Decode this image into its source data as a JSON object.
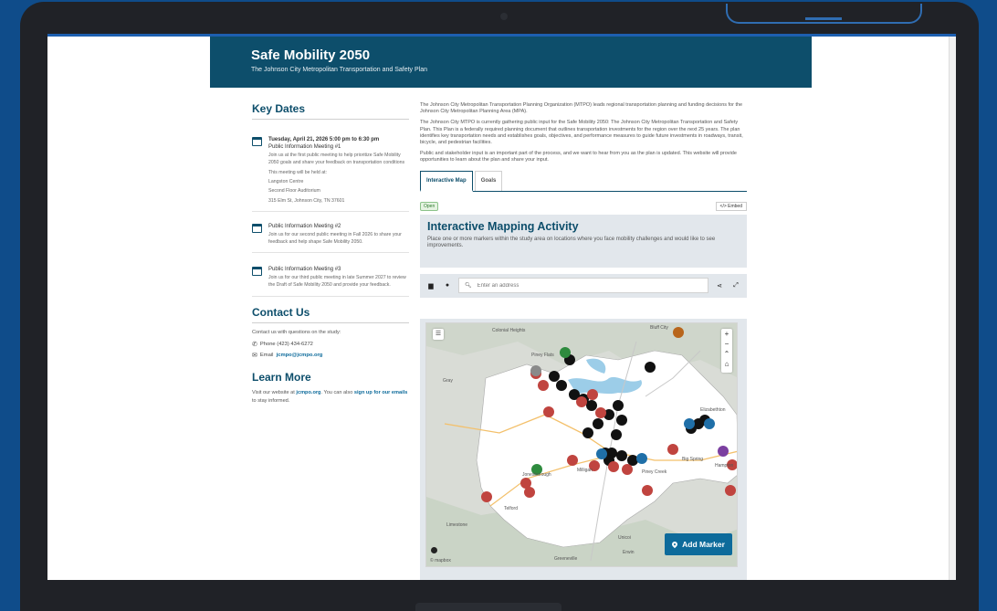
{
  "site": {
    "title": "Safe Mobility 2050",
    "subtitle": "The Johnson City Metropolitan Transportation and Safety Plan"
  },
  "key_dates": {
    "heading": "Key Dates",
    "events": [
      {
        "date": "Tuesday, April 21, 2026 5:00 pm to 6:30 pm",
        "title": "Public Information Meeting #1",
        "desc": "Join us at the first public meeting to help prioritize Safe Mobility 2050 goals and share your feedback on transportation conditions",
        "held_at": "This meeting will be held at:",
        "venue": "Langston Centre",
        "room": "Second Floor Auditorium",
        "address": "315 Elm St, Johnson City, TN 37601"
      },
      {
        "title": "Public Information Meeting #2",
        "desc": "Join us for our second public meeting in Fall 2026 to share your feedback and help shape Safe Mobility 2050."
      },
      {
        "title": "Public Information Meeting #3",
        "desc": "Join us for our third public meeting in late Summer 2027 to review the Draft of Safe Mobility 2050 and provide your feedback."
      }
    ]
  },
  "contact": {
    "heading": "Contact Us",
    "intro": "Contact us with questions on the study:",
    "phone_label": "Phone",
    "phone": "(423) 434-6272",
    "email_label": "Email",
    "email": "jcmpo@jcmpo.org"
  },
  "learn_more": {
    "heading": "Learn More",
    "text_1": "Visit our website at",
    "website": "jcmpo.org",
    "text_2": ". You can also",
    "signup": "sign up for our emails",
    "text_3": "to stay informed."
  },
  "intro": {
    "p1": "The Johnson City Metropolitan Transportation Planning Organization (MTPO) leads regional transportation planning and funding decisions for the Johnson City Metropolitan Planning Area (MPA).",
    "p2": "The Johnson City MTPO is currently gathering public input for the Safe Mobility 2050: The Johnson City Metropolitan Transportation and Safety Plan. This Plan is a federally required planning document that outlines transportation investments for the region over the next 25 years. The plan identifies key transportation needs and establishes goals, objectives, and performance measures to guide future investments in roadways, transit, bicycle, and pedestrian facilities.",
    "p3": "Public and stakeholder input is an important part of the process, and we want to hear from you as the plan is updated. This website will provide opportunities to learn about the plan and share your input."
  },
  "tabs": [
    {
      "label": "Interactive Map",
      "active": true
    },
    {
      "label": "Goals",
      "active": false
    }
  ],
  "activity": {
    "status_badge": "Open",
    "embed_label": "</> Embed",
    "title": "Interactive Mapping Activity",
    "description": "Place one or more markers within the study area on locations where you face mobility challenges and would like to see improvements.",
    "search_placeholder": "Enter an address",
    "add_marker_label": "Add Marker",
    "attribution": "© mapbox"
  },
  "map_labels": {
    "colonial_heights": "Colonial Heights",
    "bluff_city": "Bluff City",
    "piney_flats": "Piney Flats",
    "gray": "Gray",
    "jonesborough": "Jonesborough",
    "telford": "Telford",
    "limestone": "Limestone",
    "elizabethton": "Elizabethton",
    "unicoi": "Unicoi",
    "erwin": "Erwin",
    "greeneville": "Greeneville",
    "piney_creek": "Piney Creek",
    "big_spring": "Big Spring",
    "hampton": "Hampton",
    "milligan": "Milligan"
  },
  "colors": {
    "brand": "#0d4e6b",
    "accent_button": "#0d6b9b",
    "marker_red": "#c0443f",
    "marker_black": "#111111",
    "marker_green": "#2e8b3e",
    "marker_blue": "#1f6fa8",
    "marker_purple": "#7b3fa0"
  },
  "icons": {
    "calendar": "calendar-icon",
    "phone": "phone-icon",
    "email": "email-icon",
    "search": "search-icon",
    "share": "share-icon",
    "fullscreen": "expand-icon",
    "layers": "layers-icon",
    "zoom_in": "plus-icon",
    "zoom_out": "minus-icon",
    "compass": "compass-icon",
    "home": "home-icon",
    "pin": "pin-icon"
  }
}
